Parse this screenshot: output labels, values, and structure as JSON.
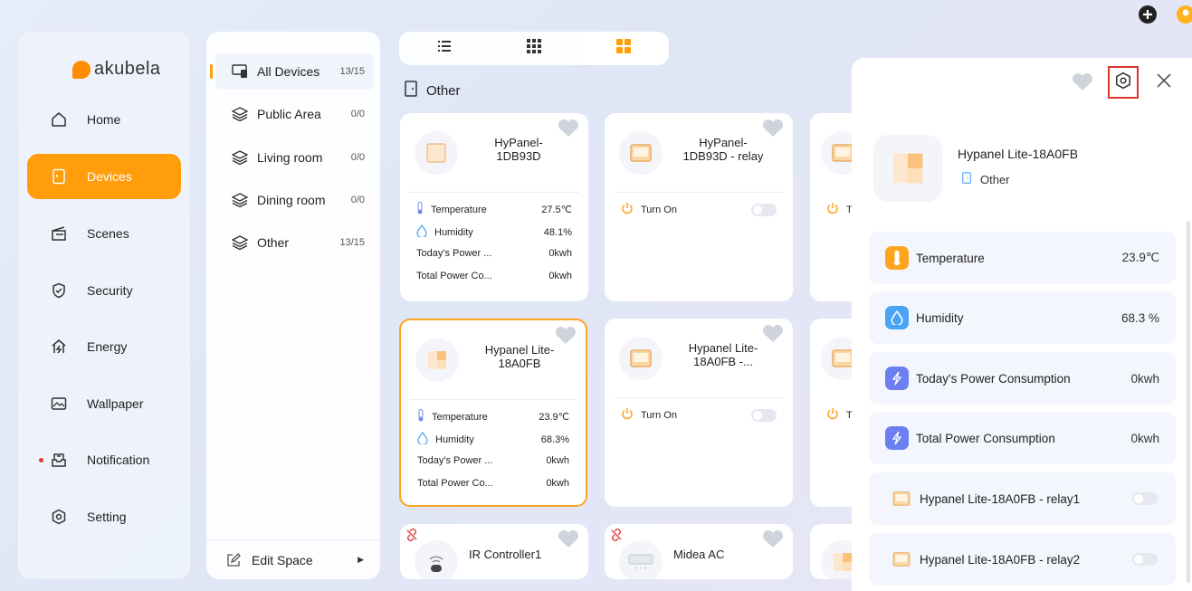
{
  "colors": {
    "accent": "#ff9d0a",
    "highlight_border": "#d9372c",
    "notification": "#e23c3c"
  },
  "sidebar": {
    "logo": "akubela",
    "items": [
      {
        "label": "Home",
        "icon": "home-icon"
      },
      {
        "label": "Devices",
        "icon": "devices-icon",
        "active": true
      },
      {
        "label": "Scenes",
        "icon": "scenes-icon"
      },
      {
        "label": "Security",
        "icon": "shield-icon"
      },
      {
        "label": "Energy",
        "icon": "energy-icon"
      },
      {
        "label": "Wallpaper",
        "icon": "wallpaper-icon"
      },
      {
        "label": "Notification",
        "icon": "notification-icon",
        "has_dot": true
      },
      {
        "label": "Setting",
        "icon": "gear-icon"
      }
    ]
  },
  "spaces": {
    "items": [
      {
        "label": "All Devices",
        "count": "13/15",
        "icon": "all-devices-icon"
      },
      {
        "label": "Public Area",
        "count": "0/0",
        "icon": "layers-icon"
      },
      {
        "label": "Living room",
        "count": "0/0",
        "icon": "layers-icon"
      },
      {
        "label": "Dining room",
        "count": "0/0",
        "icon": "layers-icon"
      },
      {
        "label": "Other",
        "count": "13/15",
        "icon": "layers-icon"
      }
    ],
    "edit_label": "Edit Space"
  },
  "view_modes": [
    "list-view-icon",
    "grid-view-icon",
    "card-view-icon"
  ],
  "section": {
    "title": "Other"
  },
  "cards": {
    "c1": {
      "name_line1": "HyPanel-",
      "name_line2": "1DB93D",
      "temp_label": "Temperature",
      "temp": "27.5℃",
      "hum_label": "Humidity",
      "hum": "48.1%",
      "today_label": "Today's Power ...",
      "today": "0kwh",
      "total_label": "Total Power Co...",
      "total": "0kwh"
    },
    "c2": {
      "name_line1": "HyPanel-",
      "name_line2": "1DB93D - relay",
      "action": "Turn On"
    },
    "c3": {
      "action": "T"
    },
    "c4": {
      "name_line1": "Hypanel Lite-",
      "name_line2": "18A0FB",
      "temp_label": "Temperature",
      "temp": "23.9℃",
      "hum_label": "Humidity",
      "hum": "68.3%",
      "today_label": "Today's Power ...",
      "today": "0kwh",
      "total_label": "Total Power Co...",
      "total": "0kwh"
    },
    "c5": {
      "name_line1": "Hypanel Lite-",
      "name_line2": "18A0FB -...",
      "action": "Turn On"
    },
    "c6": {
      "action": "T"
    },
    "c7": {
      "name": "IR Controller1"
    },
    "c8": {
      "name": "Midea AC"
    }
  },
  "detail": {
    "device_name": "Hypanel Lite-18A0FB",
    "room": "Other",
    "properties": [
      {
        "label": "Temperature",
        "value": "23.9℃",
        "icon": "thermometer-icon",
        "color": "#ffa41e"
      },
      {
        "label": "Humidity",
        "value": "68.3 %",
        "icon": "water-drop-icon",
        "color": "#4aa3f5"
      },
      {
        "label": "Today's Power Consumption",
        "value": "0kwh",
        "icon": "lightning-icon",
        "color": "#6b7ff0"
      },
      {
        "label": "Total Power Consumption",
        "value": "0kwh",
        "icon": "lightning-icon",
        "color": "#6b7ff0"
      }
    ],
    "relays": [
      {
        "label": "Hypanel Lite-18A0FB - relay1",
        "state": "off"
      },
      {
        "label": "Hypanel Lite-18A0FB - relay2",
        "state": "off"
      }
    ]
  }
}
